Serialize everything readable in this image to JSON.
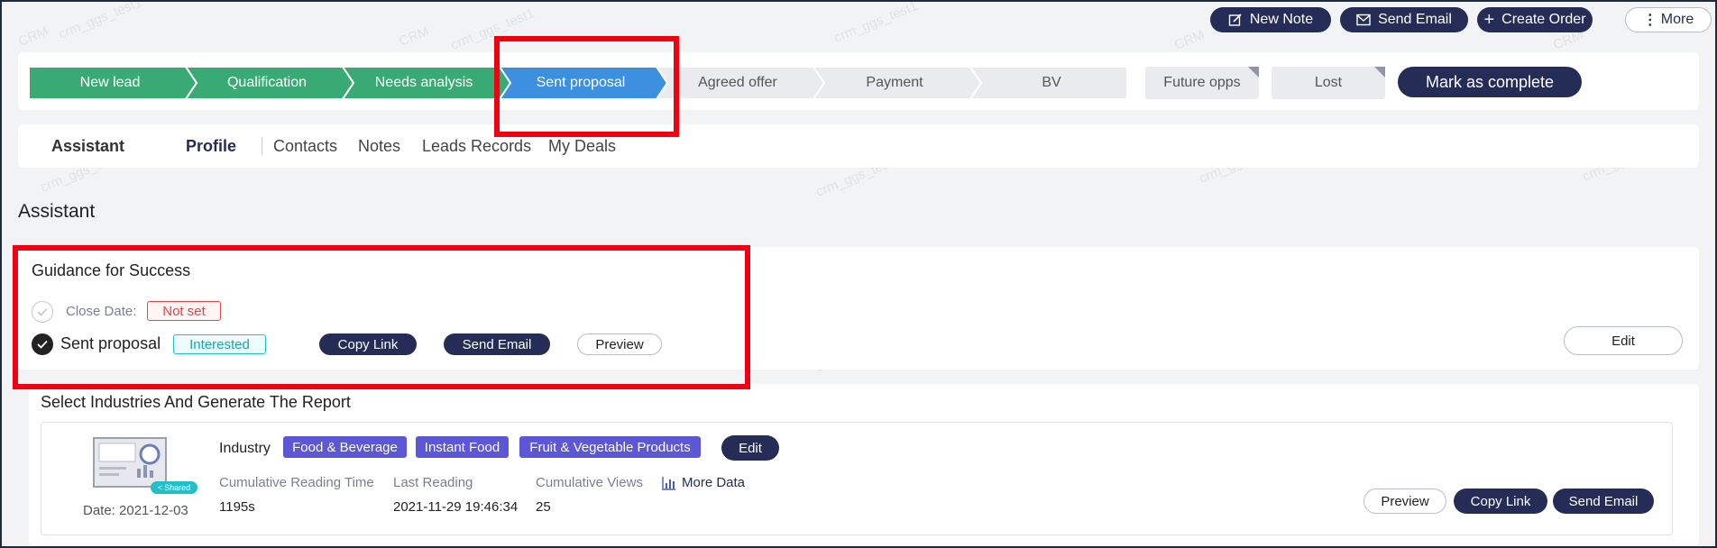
{
  "toolbar": {
    "new_note": "New Note",
    "send_email": "Send Email",
    "create_order": "Create Order",
    "more": "More"
  },
  "pipeline": {
    "stages": [
      "New lead",
      "Qualification",
      "Needs analysis",
      "Sent proposal",
      "Agreed offer",
      "Payment",
      "BV"
    ],
    "current_stage": "Sent proposal",
    "extra_stages": [
      "Future opps",
      "Lost"
    ],
    "mark_complete": "Mark as complete"
  },
  "tabs": {
    "assistant": "Assistant",
    "profile": "Profile",
    "contacts": "Contacts",
    "notes": "Notes",
    "leads_records": "Leads Records",
    "my_deals": "My Deals",
    "active": "Profile"
  },
  "assistant": {
    "heading": "Assistant",
    "guidance": {
      "title": "Guidance for Success",
      "close_date_label": "Close Date:",
      "close_date_value": "Not set",
      "step_label": "Sent proposal",
      "step_status": "Interested",
      "copy_link": "Copy Link",
      "send_email": "Send Email",
      "preview": "Preview",
      "edit": "Edit"
    }
  },
  "report": {
    "title": "Select Industries And Generate The Report",
    "thumbnail_badge": "Shared",
    "date": "Date: 2021-12-03",
    "industry_label": "Industry",
    "industries": [
      "Food & Beverage",
      "Instant Food",
      "Fruit & Vegetable Products"
    ],
    "edit": "Edit",
    "stats": {
      "reading_time_label": "Cumulative Reading Time",
      "reading_time_value": "1195s",
      "last_reading_label": "Last Reading",
      "last_reading_value": "2021-11-29 19:46:34",
      "views_label": "Cumulative Views",
      "views_value": "25",
      "more_data": "More Data"
    },
    "preview": "Preview",
    "copy_link": "Copy Link",
    "send_email": "Send Email"
  },
  "watermarks": [
    "CRM",
    "crm_ggs_test1"
  ],
  "colors": {
    "stage_done": "#3aaa75",
    "stage_current": "#3d8fe0",
    "stage_todo": "#e9ebef",
    "navy": "#252d57",
    "tag": "#5b57d6",
    "status_teal": "#20c0c8",
    "not_set_red": "#e04848",
    "highlight": "#f00010"
  }
}
